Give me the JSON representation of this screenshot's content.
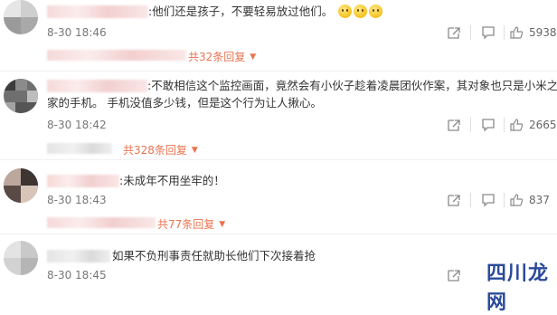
{
  "comments": [
    {
      "text": ":他们还是孩子，不要轻易放过他们。",
      "time": "8-30 18:46",
      "likes": "5938",
      "replies": "共32条回复",
      "emoji_count": 3
    },
    {
      "text_line1": ":不敢相信这个监控画面，竟然会有小伙子趁着凌晨团伙作案，其对象也只是小米之",
      "text_line2": "家的手机。 手机没值多少钱，但是这个行为让人揪心。",
      "time": "8-30 18:42",
      "likes": "2665",
      "replies": "共328条回复"
    },
    {
      "text": ":未成年不用坐牢的！",
      "time": "8-30 18:43",
      "likes": "837",
      "replies": "共77条回复"
    },
    {
      "text": "如果不负刑事责任就助长他们下次接着抢",
      "time": "8-30 18:45"
    }
  ],
  "watermark": {
    "text": "四川龙网"
  },
  "icons": {
    "share": "share-icon",
    "comment": "comment-icon",
    "like": "thumbs-up-icon",
    "expand": "triangle-down-icon"
  },
  "colors": {
    "reply_link": "#eb7350",
    "time": "#777777",
    "watermark": "#2a4b9b"
  }
}
